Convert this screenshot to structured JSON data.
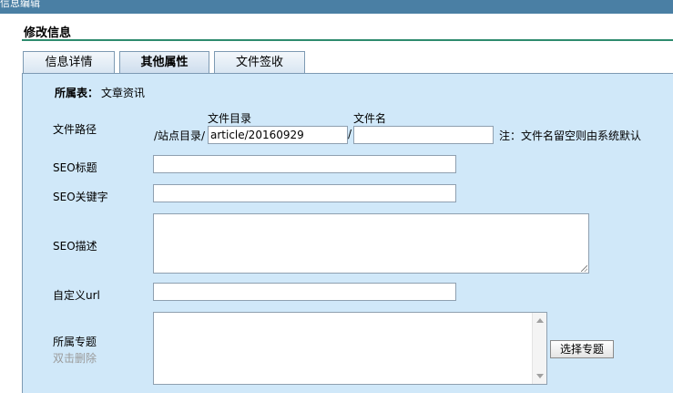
{
  "window": {
    "title": "信息编辑"
  },
  "section": {
    "title": "修改信息"
  },
  "tabs": [
    {
      "label": "信息详情"
    },
    {
      "label": "其他属性"
    },
    {
      "label": "文件签收"
    }
  ],
  "form": {
    "belongs_label": "所属表：",
    "belongs_value": "文章资讯",
    "file_path": {
      "label": "文件路径",
      "dir_caption": "文件目录",
      "name_caption": "文件名",
      "prefix": "/站点目录/",
      "dir_value": "article/20160929",
      "separator": "/",
      "name_value": "",
      "note": "注：文件名留空则由系统默认"
    },
    "seo_title": {
      "label": "SEO标题",
      "value": ""
    },
    "seo_keywords": {
      "label": "SEO关键字",
      "value": ""
    },
    "seo_description": {
      "label": "SEO描述",
      "value": ""
    },
    "custom_url": {
      "label": "自定义url",
      "value": ""
    },
    "topic": {
      "label": "所属专题",
      "hint": "双击删除",
      "button_label": "选择专题"
    }
  }
}
